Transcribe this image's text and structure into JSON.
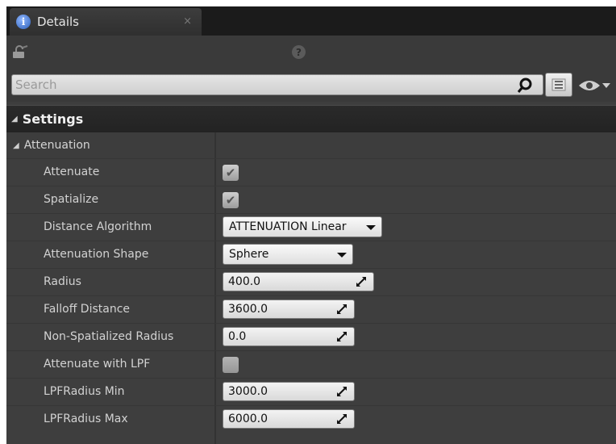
{
  "tab": {
    "label": "Details",
    "close": "×"
  },
  "search": {
    "placeholder": "Search"
  },
  "category": {
    "label": "Settings"
  },
  "subgroup": {
    "label": "Attenuation"
  },
  "properties": {
    "attenuate": {
      "label": "Attenuate",
      "checked": true,
      "mark": "✔"
    },
    "spatialize": {
      "label": "Spatialize",
      "checked": true,
      "mark": "✔"
    },
    "distance_algorithm": {
      "label": "Distance Algorithm",
      "value": "ATTENUATION Linear"
    },
    "attenuation_shape": {
      "label": "Attenuation Shape",
      "value": "Sphere"
    },
    "radius": {
      "label": "Radius",
      "value": "400.0"
    },
    "falloff_distance": {
      "label": "Falloff Distance",
      "value": "3600.0"
    },
    "non_spatialized_radius": {
      "label": "Non-Spatialized Radius",
      "value": "0.0"
    },
    "attenuate_with_lpf": {
      "label": "Attenuate with LPF",
      "checked": false
    },
    "lpf_radius_min": {
      "label": "LPFRadius Min",
      "value": "3000.0"
    },
    "lpf_radius_max": {
      "label": "LPFRadius Max",
      "value": "6000.0"
    }
  },
  "icons": {
    "tab": "info-icon",
    "lock": "lock-icon",
    "help": "help-icon",
    "search": "search-icon",
    "view_options": "view-options-icon",
    "visibility": "eye-icon"
  },
  "colors": {
    "panel_bg": "#3e3e3e",
    "header_bg": "#232323",
    "field_bg": "#e6e6e6"
  }
}
